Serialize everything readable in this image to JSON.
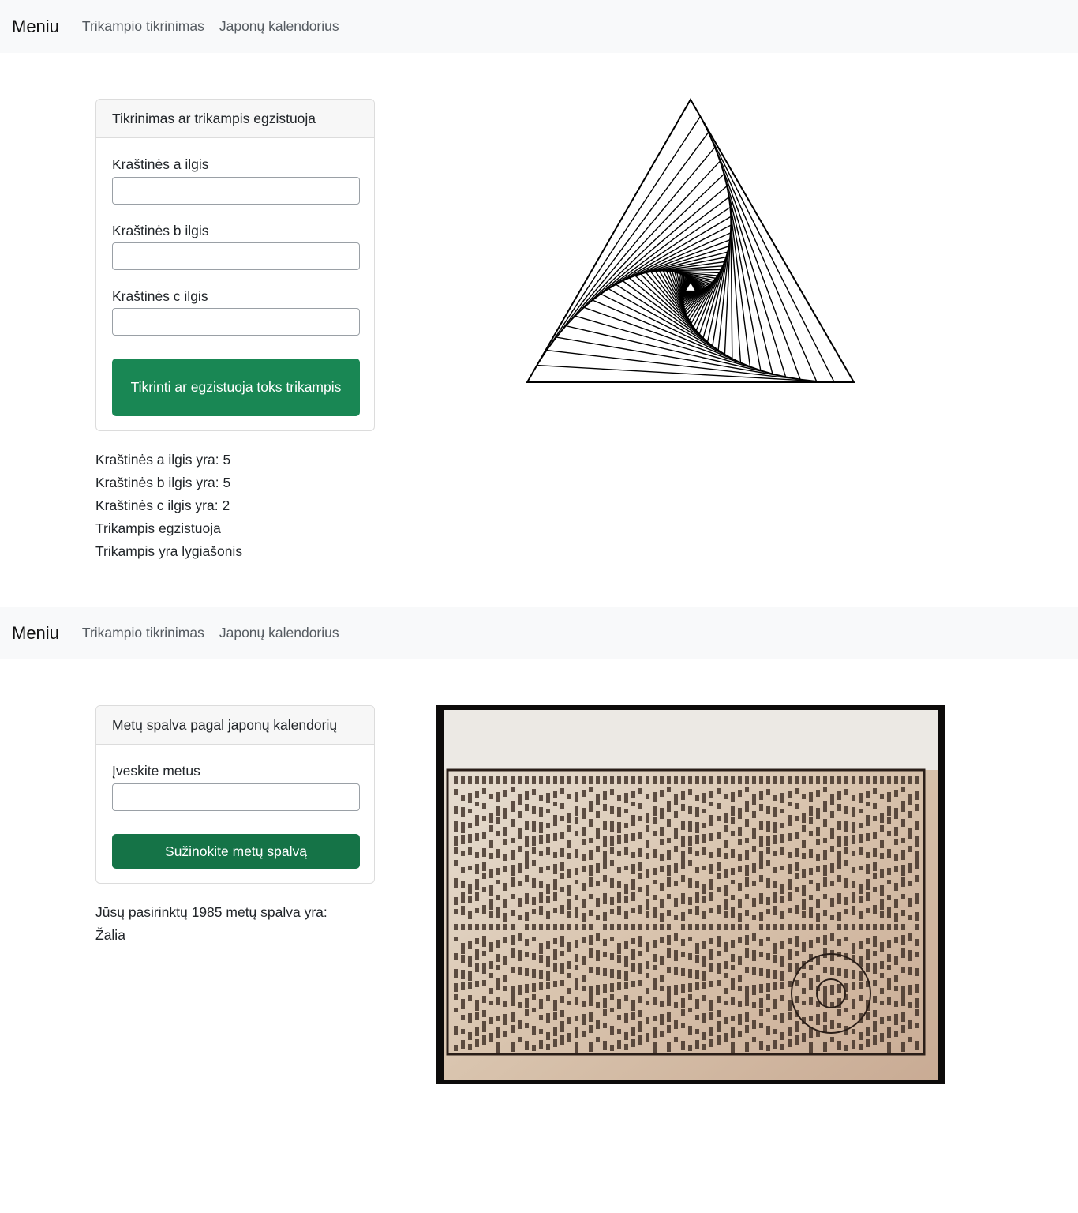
{
  "nav": {
    "brand": "Meniu",
    "links": [
      "Trikampio tikrinimas",
      "Japonų kalendorius"
    ]
  },
  "triangle_section": {
    "card_title": "Tikrinimas ar trikampis egzistuoja",
    "fields": [
      {
        "label": "Kraštinės a ilgis",
        "value": ""
      },
      {
        "label": "Kraštinės b ilgis",
        "value": ""
      },
      {
        "label": "Kraštinės c ilgis",
        "value": ""
      }
    ],
    "button_label": "Tikrinti ar egzistuoja toks trikampis",
    "results": [
      "Kraštinės a ilgis yra: 5",
      "Kraštinės b ilgis yra: 5",
      "Kraštinės c ilgis yra: 2",
      "Trikampis egzistuoja",
      "Trikampis yra lygiašonis"
    ]
  },
  "calendar_section": {
    "card_title": "Metų spalva pagal japonų kalendorių",
    "field_label": "Įveskite metus",
    "field_value": "",
    "button_label": "Sužinokite metų spalvą",
    "result_line1": "Jūsų pasirinktų 1985 metų spalva yra:",
    "result_line2": "Žalia"
  },
  "colors": {
    "navbar_bg": "#f8f9fa",
    "button_success": "#198754",
    "button_success_dark": "#157347"
  },
  "icons": {
    "triangle_figure": "nested-spiral-triangle",
    "calendar_image": "japanese-calendar-print"
  }
}
